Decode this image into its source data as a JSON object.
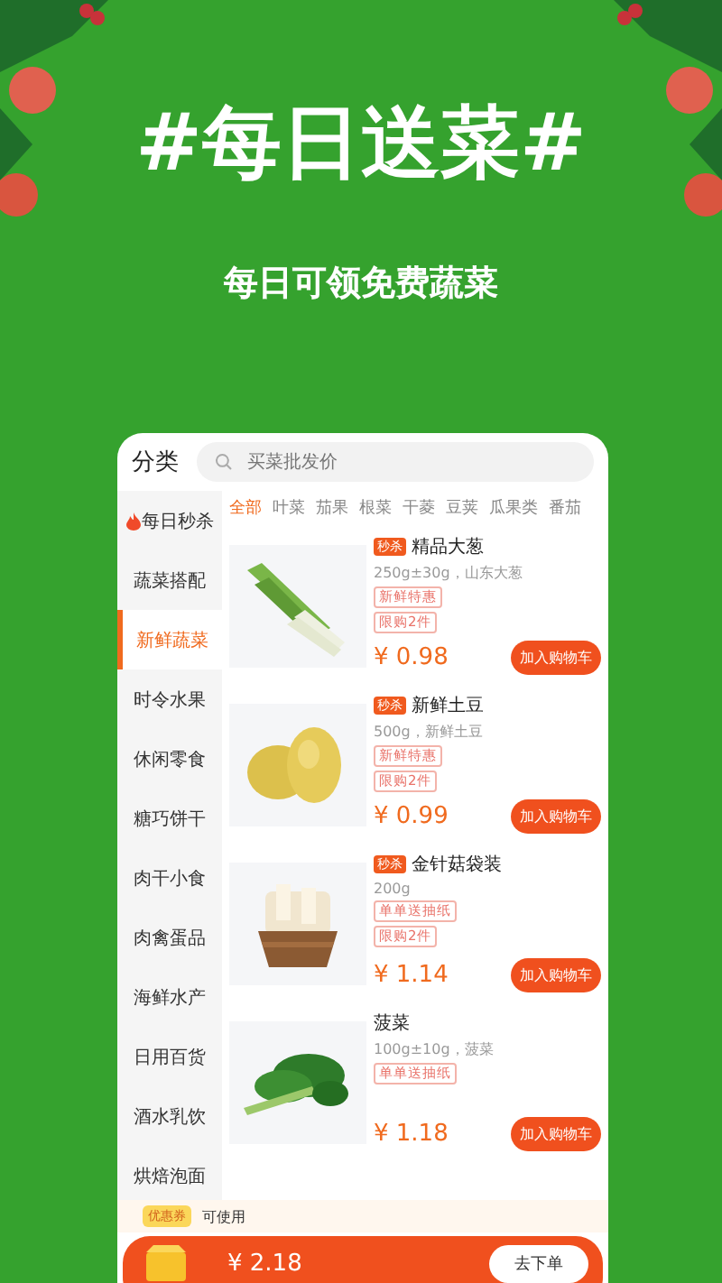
{
  "banner": {
    "title": "#每日送菜#",
    "subtitle": "每日可领免费蔬菜"
  },
  "header": {
    "title": "分类",
    "search": {
      "placeholder": "买菜批发价"
    }
  },
  "sidebar": {
    "items": [
      {
        "label": "每日秒杀",
        "selected": false,
        "hot": true
      },
      {
        "label": "蔬菜搭配",
        "selected": false,
        "hot": false
      },
      {
        "label": "新鲜蔬菜",
        "selected": true,
        "hot": false
      },
      {
        "label": "时令水果",
        "selected": false,
        "hot": false
      },
      {
        "label": "休闲零食",
        "selected": false,
        "hot": false
      },
      {
        "label": "糖巧饼干",
        "selected": false,
        "hot": false
      },
      {
        "label": "肉干小食",
        "selected": false,
        "hot": false
      },
      {
        "label": "肉禽蛋品",
        "selected": false,
        "hot": false
      },
      {
        "label": "海鲜水产",
        "selected": false,
        "hot": false
      },
      {
        "label": "日用百货",
        "selected": false,
        "hot": false
      },
      {
        "label": "酒水乳饮",
        "selected": false,
        "hot": false
      },
      {
        "label": "烘焙泡面",
        "selected": false,
        "hot": false
      }
    ]
  },
  "tabs": [
    {
      "label": "全部",
      "selected": true
    },
    {
      "label": "叶菜",
      "selected": false
    },
    {
      "label": "茄果",
      "selected": false
    },
    {
      "label": "根菜",
      "selected": false
    },
    {
      "label": "干菱",
      "selected": false
    },
    {
      "label": "豆荚",
      "selected": false
    },
    {
      "label": "瓜果类",
      "selected": false
    },
    {
      "label": "番茄",
      "selected": false
    }
  ],
  "products": [
    {
      "kind": "onion",
      "tag": "秒杀",
      "name": "精品大葱",
      "spec": "250g±30g，山东大葱",
      "badges": [
        "新鲜特惠",
        "限购2件"
      ],
      "price": "¥ 0.98",
      "button": "加入购物车"
    },
    {
      "kind": "potato",
      "tag": "秒杀",
      "name": "新鲜土豆",
      "spec": "500g，新鲜土豆",
      "badges": [
        "新鲜特惠",
        "限购2件"
      ],
      "price": "¥ 0.99",
      "button": "加入购物车"
    },
    {
      "kind": "mushroom",
      "tag": "秒杀",
      "name": "金针菇袋装",
      "spec": "200g",
      "badges": [
        "单单送抽纸",
        "限购2件"
      ],
      "price": "¥ 1.14",
      "button": "加入购物车"
    },
    {
      "kind": "spinach",
      "name": "菠菜",
      "spec": "100g±10g，菠菜",
      "badges": [
        "单单送抽纸"
      ],
      "price": "¥ 1.18",
      "button": "加入购物车"
    }
  ],
  "coupon": {
    "tag": "优惠券",
    "text": "可使用"
  },
  "cart": {
    "total": "¥ 2.18",
    "button": "去下单"
  }
}
